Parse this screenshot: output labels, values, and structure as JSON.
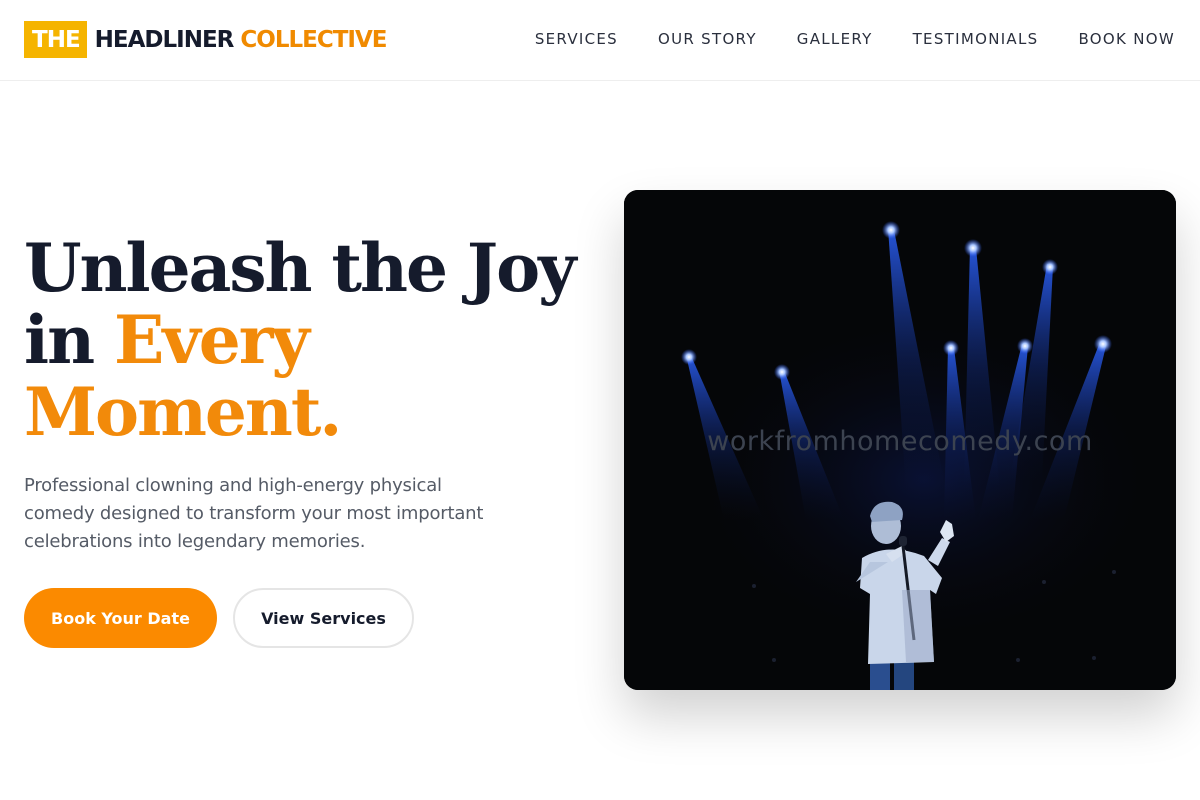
{
  "brand": {
    "part1": "THE",
    "part2": "HEADLINER",
    "part3": "COLLECTIVE"
  },
  "nav": [
    {
      "label": "SERVICES"
    },
    {
      "label": "OUR STORY"
    },
    {
      "label": "GALLERY"
    },
    {
      "label": "TESTIMONIALS"
    },
    {
      "label": "BOOK NOW"
    }
  ],
  "hero": {
    "title_line1": "Unleash the Joy",
    "title_line2_a": "in",
    "title_line2_b": "Every",
    "title_line3": "Moment.",
    "subtitle": "Professional clowning and high-energy physical comedy designed to transform your most important celebrations into legendary memories.",
    "primary_button": "Book Your Date",
    "secondary_button": "View Services",
    "image_watermark": "workfromhomecomedy.com"
  },
  "colors": {
    "accent": "#fb8a00",
    "logo_box": "#f5b400",
    "heading": "#151b2c",
    "image_bg": "#050608",
    "spotlight": "#2a5cff"
  },
  "icons": [
    "spotlight-icon",
    "performer-silhouette-icon"
  ]
}
